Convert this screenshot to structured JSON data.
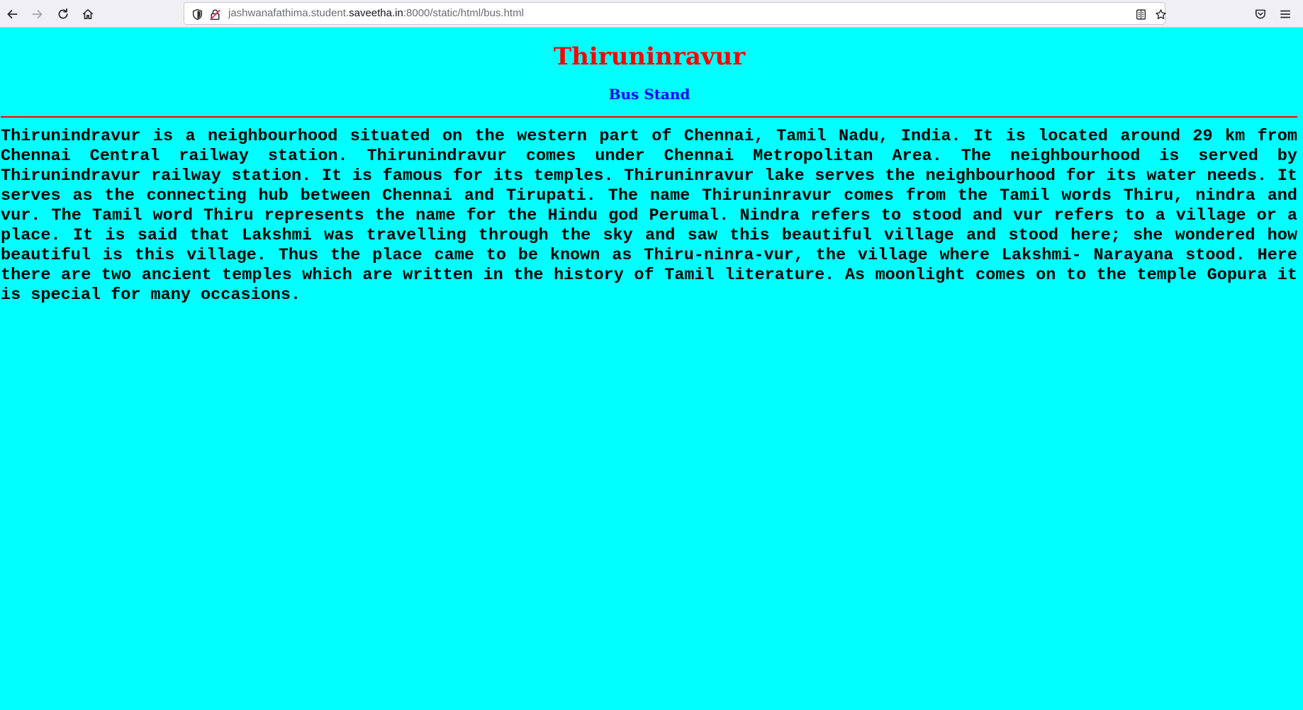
{
  "browser": {
    "url_prefix": "jashwanafathima.student.",
    "url_domain": "saveetha.in",
    "url_suffix": ":8000/static/html/bus.html",
    "icons": {
      "back": "back-arrow-icon",
      "forward": "forward-arrow-icon",
      "reload": "reload-icon",
      "home": "home-icon",
      "shield": "tracking-protection-shield-icon",
      "insecure": "insecure-connection-icon",
      "reader": "reader-view-icon",
      "bookmark": "bookmark-star-icon",
      "pocket": "pocket-icon",
      "menu": "hamburger-menu-icon"
    }
  },
  "page": {
    "title": "Thiruninravur",
    "subtitle": "Bus Stand",
    "paragraph": "Thirunindravur is a neighbourhood situated on the western part of Chennai, Tamil Nadu, India. It is located around 29 km from Chennai Central railway station. Thirunindravur comes under Chennai Metropolitan Area. The neighbourhood is served by Thirunindravur railway station. It is famous for its temples. Thiruninravur lake serves the neighbourhood for its water needs. It serves as the connecting hub between Chennai and Tirupati. The name Thiruninravur comes from the Tamil words Thiru, nindra and vur. The Tamil word Thiru represents the name for the Hindu god Perumal. Nindra refers to stood and vur refers to a village or a place. It is said that Lakshmi was travelling through the sky and saw this beautiful village and stood here; she wondered how beautiful is this village. Thus the place came to be known as Thiru-ninra-vur, the village where Lakshmi- Narayana stood. Here there are two ancient temples which are written in the history of Tamil literature. As moonlight comes on to the temple Gopura it is special for many occasions.",
    "colors": {
      "background": "#00ffff",
      "title": "#ff0000",
      "subtitle": "#0000ff",
      "divider": "#ff0000",
      "text": "#000000"
    }
  }
}
